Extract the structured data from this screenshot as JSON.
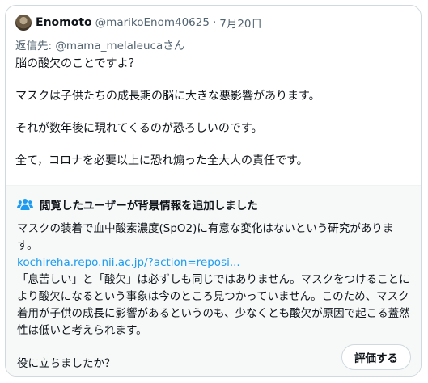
{
  "tweet": {
    "display_name": "Enomoto",
    "handle": "@marikoEnom40625",
    "separator": "·",
    "date": "7月20日",
    "reply_prefix": "返信先: ",
    "reply_mention": "@mama_melaleuca",
    "reply_suffix": "さん",
    "lines": [
      "脳の酸欠のことですよ？",
      "マスクは子供たちの成長期の脳に大きな悪影響があります。",
      "それが数年後に現れてくるのが恐ろしいのです。",
      "全て，コロナを必要以上に恐れ煽った全大人の責任です。"
    ]
  },
  "community_note": {
    "icon": "people-icon",
    "title": "閲覧したユーザーが背景情報を追加しました",
    "paragraph1": "マスクの装着で血中酸素濃度(SpO2)に有意な変化はないという研究があります。",
    "link": "kochireha.repo.nii.ac.jp/?action=reposi...",
    "paragraph2": "「息苦しい」と「酸欠」は必ずしも同じではありません。マスクをつけることにより酸欠になるという事象は今のところ見つかっていません。このため、マスク着用が子供の成長に影響があるというのも、少なくとも酸欠が原因で起こる蓋然性は低いと考えられます。",
    "helpful_question": "役に立ちましたか？",
    "rate_button": "評価する"
  },
  "colors": {
    "text": "#0f1419",
    "secondary": "#536471",
    "link": "#1d9bf0",
    "border": "#cfd9de",
    "note_background": "#f7f9f9",
    "note_icon": "#1d9bf0"
  }
}
